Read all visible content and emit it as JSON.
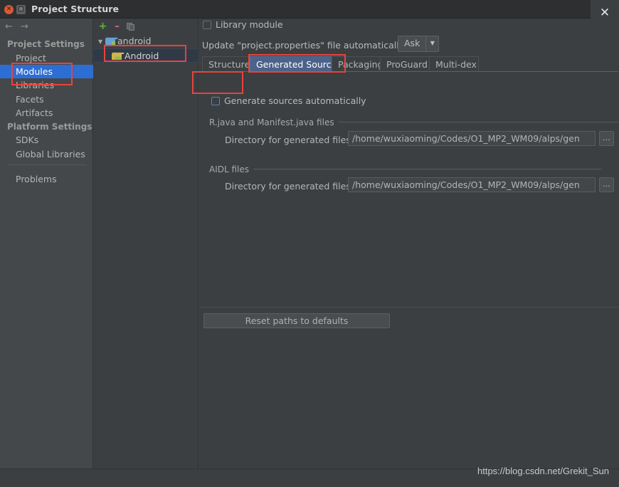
{
  "window": {
    "title": "Project Structure",
    "close_icon": "close-icon",
    "minimize_icon": "close-round-icon",
    "maximize_icon": "maximize-round-icon"
  },
  "sidebar": {
    "nav": {
      "back_icon": "arrow-left-icon",
      "forward_icon": "arrow-right-icon"
    },
    "groups": [
      {
        "label": "Project Settings",
        "items": [
          {
            "label": "Project",
            "selected": false
          },
          {
            "label": "Modules",
            "selected": true
          },
          {
            "label": "Libraries",
            "selected": false
          },
          {
            "label": "Facets",
            "selected": false
          },
          {
            "label": "Artifacts",
            "selected": false
          }
        ]
      },
      {
        "label": "Platform Settings",
        "items": [
          {
            "label": "SDKs",
            "selected": false
          },
          {
            "label": "Global Libraries",
            "selected": false
          }
        ]
      }
    ],
    "problems": {
      "label": "Problems"
    }
  },
  "modules_panel": {
    "toolbar": {
      "add_icon": "plus-icon",
      "remove_icon": "minus-icon",
      "copy_icon": "copy-icon"
    },
    "tree": {
      "root": {
        "label": "android",
        "icon": "folder-module-icon",
        "expander": "▼"
      },
      "child": {
        "label": "Android",
        "icon": "android-facet-icon",
        "selected": true
      }
    }
  },
  "main": {
    "library_module": {
      "label": "Library module",
      "checked": false
    },
    "update_row": {
      "label": "Update \"project.properties\" file automatically:",
      "combo_value": "Ask",
      "combo_arrow": "▼"
    },
    "tabs": [
      {
        "label": "Structure",
        "active": false
      },
      {
        "label": "Generated Sources",
        "active": true
      },
      {
        "label": "Packaging",
        "active": false
      },
      {
        "label": "ProGuard",
        "active": false
      },
      {
        "label": "Multi-dex",
        "active": false
      }
    ],
    "generate_sources": {
      "label": "Generate sources automatically",
      "checked": false
    },
    "sections": [
      {
        "title": "R.java and Manifest.java files",
        "field_label": "Directory for generated files:",
        "field_value": "/home/wuxiaoming/Codes/O1_MP2_WM09/alps/gen",
        "browse_label": "..."
      },
      {
        "title": "AIDL files",
        "field_label": "Directory for generated files:",
        "field_value": "/home/wuxiaoming/Codes/O1_MP2_WM09/alps/gen",
        "browse_label": "..."
      }
    ],
    "reset_button": {
      "label": "Reset paths to defaults"
    }
  },
  "watermark": {
    "text": "https://blog.csdn.net/Grekit_Sun"
  },
  "colors": {
    "window_bg": "#3c3f41",
    "sidebar_bg": "#45484a",
    "selection_blue": "#2d6ed4",
    "tab_active_blue": "#4c6288",
    "annotation_red": "#e8433c",
    "tree_selection": "#2f3a46"
  }
}
